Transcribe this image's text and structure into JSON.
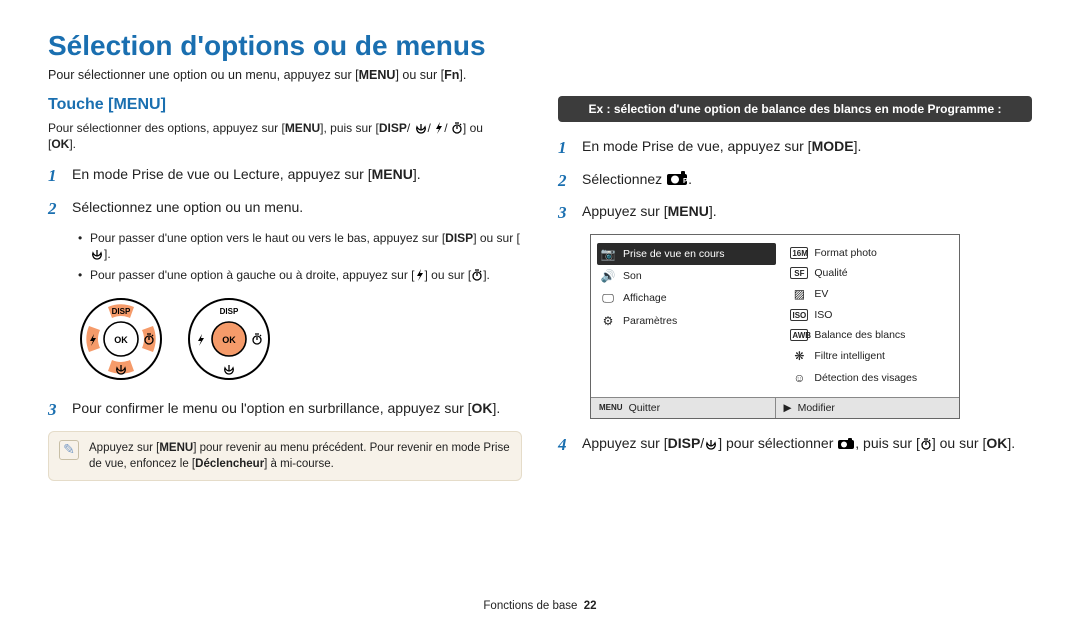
{
  "page_title": "Sélection d'options ou de menus",
  "intro_text_1": "Pour sélectionner une option ou un menu, appuyez sur [",
  "intro_menu": "MENU",
  "intro_text_2": "] ou sur [",
  "intro_fn": "Fn",
  "intro_text_3": "].",
  "left": {
    "heading": "Touche [MENU]",
    "intro_pre": "Pour sélectionner des options, appuyez sur [",
    "intro_menu": "MENU",
    "intro_mid": "], puis sur [",
    "intro_disp": "DISP",
    "intro_or": "] ou",
    "intro_ok": "OK",
    "step1_pre": "En mode Prise de vue ou Lecture, appuyez sur [",
    "step1_menu": "MENU",
    "step1_post": "].",
    "step2": "Sélectionnez une option ou un menu.",
    "bullet1_pre": "Pour passer d'une option vers le haut ou vers le bas, appuyez sur [",
    "bullet1_disp": "DISP",
    "bullet1_mid": "] ou sur [",
    "bullet1_post": "].",
    "bullet2_pre": "Pour passer d'une option à gauche ou à droite, appuyez sur [",
    "bullet2_mid": "] ou sur [",
    "bullet2_post": "].",
    "step3_pre": "Pour confirmer le menu ou l'option en surbrillance, appuyez sur [",
    "step3_ok": "OK",
    "step3_post": "].",
    "tip_pre": "Appuyez sur [",
    "tip_menu": "MENU",
    "tip_mid": "] pour revenir au menu précédent. Pour revenir en mode Prise de vue, enfoncez le [",
    "tip_bold": "Déclencheur",
    "tip_post": "] à mi-course.",
    "dial_disp": "DISP",
    "dial_ok": "OK"
  },
  "right": {
    "example_label": "Ex : sélection d'une option de balance des blancs en mode Programme :",
    "step1_pre": "En mode Prise de vue, appuyez sur [",
    "step1_mode": "MODE",
    "step1_post": "].",
    "step2_pre": "Sélectionnez ",
    "step2_post": ".",
    "step3_pre": "Appuyez sur [",
    "step3_menu": "MENU",
    "step3_post": "].",
    "screenshot": {
      "left": [
        {
          "icon": "camera",
          "label": "Prise de vue en cours",
          "active": true
        },
        {
          "icon": "sound",
          "label": "Son"
        },
        {
          "icon": "display",
          "label": "Affichage"
        },
        {
          "icon": "gear",
          "label": "Paramètres"
        }
      ],
      "right": [
        {
          "icon_text": "16M",
          "label": "Format photo"
        },
        {
          "icon_text": "SF",
          "label": "Qualité"
        },
        {
          "icon_text": "▨",
          "label": "EV"
        },
        {
          "icon_text": "ISO",
          "label": "ISO"
        },
        {
          "icon_text": "AWB",
          "label": "Balance des blancs"
        },
        {
          "icon_text": "❋",
          "label": "Filtre intelligent"
        },
        {
          "icon_text": "☺",
          "label": "Détection des visages"
        }
      ],
      "footer_left_icon": "MENU",
      "footer_left_label": "Quitter",
      "footer_right_icon": "▶",
      "footer_right_label": "Modifier"
    },
    "step4_a": "Appuyez sur [",
    "step4_disp": "DISP",
    "step4_b": "] pour sélectionner ",
    "step4_c": ", puis sur [",
    "step4_d": "] ou sur [",
    "step4_ok": "OK",
    "step4_e": "]."
  },
  "footer_label": "Fonctions de base",
  "footer_page": "22"
}
